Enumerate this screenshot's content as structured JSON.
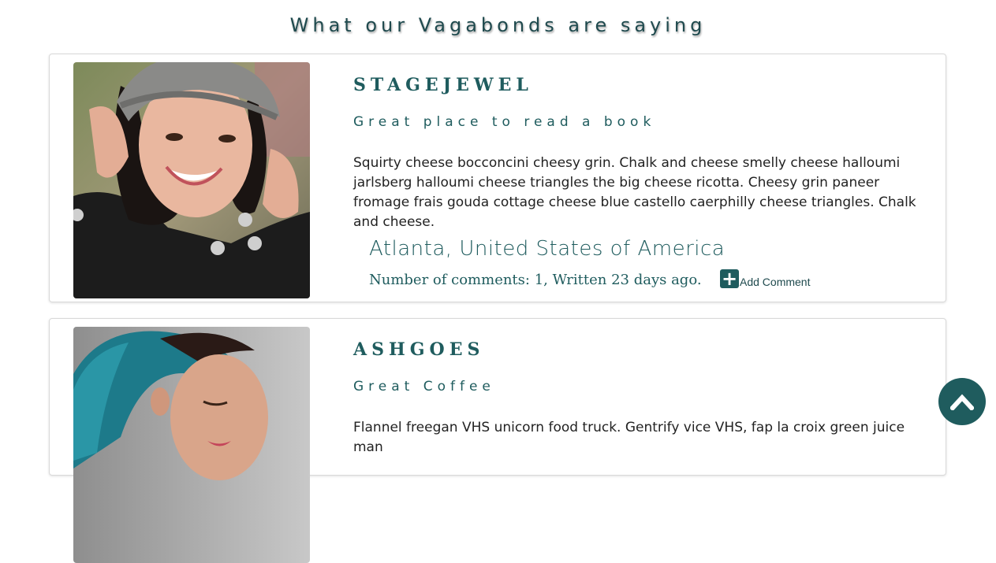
{
  "page": {
    "heading": "What our Vagabonds are saying"
  },
  "reviews": [
    {
      "username": "STAGEJEWEL",
      "title": "Great place to read a book",
      "body": "Squirty cheese bocconcini cheesy grin. Chalk and cheese smelly cheese halloumi jarlsberg halloumi cheese triangles the big cheese ricotta. Cheesy grin paneer fromage frais gouda cottage cheese blue castello caerphilly cheese triangles. Chalk and cheese.",
      "location": "Atlanta, United States of America",
      "meta": "Number of comments: 1, Written 23 days ago.",
      "add_comment_label": "Add Comment"
    },
    {
      "username": "ASHGOES",
      "title": "Great Coffee",
      "body": "Flannel freegan VHS unicorn food truck. Gentrify vice VHS, fap la croix green juice man"
    }
  ],
  "icons": {
    "add_comment": "plus-square-icon",
    "back_to_top": "chevron-up-icon"
  },
  "colors": {
    "accent": "#1f5c5e",
    "heading": "#1f4a4e",
    "body_text": "#222222"
  }
}
